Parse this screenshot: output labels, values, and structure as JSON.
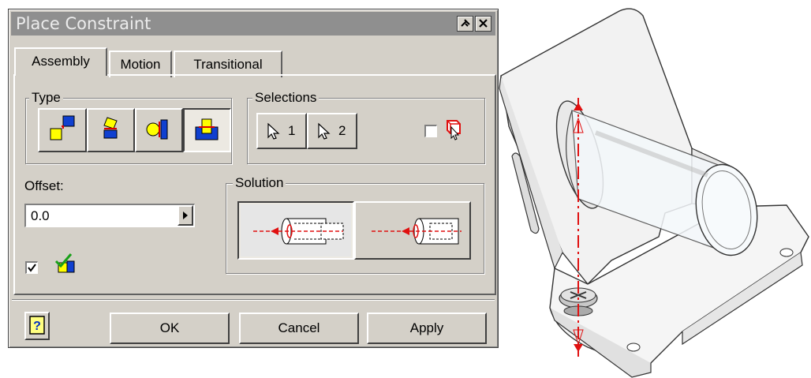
{
  "dialog": {
    "title": "Place Constraint",
    "tabs": [
      "Assembly",
      "Motion",
      "Transitional"
    ],
    "active_tab": "Assembly",
    "type_group": {
      "label": "Type",
      "buttons": [
        "mate-icon",
        "angle-icon",
        "tangent-icon",
        "insert-icon"
      ],
      "selected": "insert-icon"
    },
    "selections_group": {
      "label": "Selections",
      "select1": "1",
      "select2": "2",
      "pick_part_first_checked": false
    },
    "offset": {
      "label": "Offset:",
      "value": "0.0"
    },
    "show_preview_checked": true,
    "solution_group": {
      "label": "Solution",
      "options": [
        "opposed-solution-icon",
        "aligned-solution-icon"
      ],
      "selected": "opposed-solution-icon"
    },
    "buttons": {
      "ok": "OK",
      "cancel": "Cancel",
      "apply": "Apply"
    },
    "colors": {
      "face": "#d4d0c8",
      "title_bar": "#8f8f8f",
      "constraint_axis": "#e01010"
    }
  }
}
